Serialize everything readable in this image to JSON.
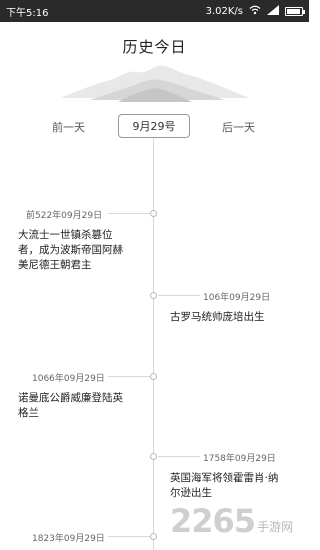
{
  "status_bar": {
    "time": "下午5:16",
    "speed": "3.02K/s"
  },
  "header": {
    "title": "历史今日"
  },
  "nav": {
    "prev_label": "前一天",
    "current_date": "9月29号",
    "next_label": "后一天"
  },
  "events": [
    {
      "date": "前522年09月29日",
      "text_lines": [
        "大流士一世镇杀篡位",
        "者，成为波斯帝国阿赫",
        "美尼德王朝君主"
      ]
    },
    {
      "date": "106年09月29日",
      "text_lines": [
        "古罗马统帅庞培出生"
      ]
    },
    {
      "date": "1066年09月29日",
      "text_lines": [
        "诺曼底公爵威廉登陆英",
        "格兰"
      ]
    },
    {
      "date": "1758年09月29日",
      "text_lines": [
        "英国海军将领霍雷肖·纳",
        "尔逊出生"
      ]
    },
    {
      "date": "1823年09月29日",
      "text_lines": []
    }
  ],
  "watermark": {
    "logo_text": "2265",
    "suffix": ".com",
    "cn": "手游网"
  }
}
